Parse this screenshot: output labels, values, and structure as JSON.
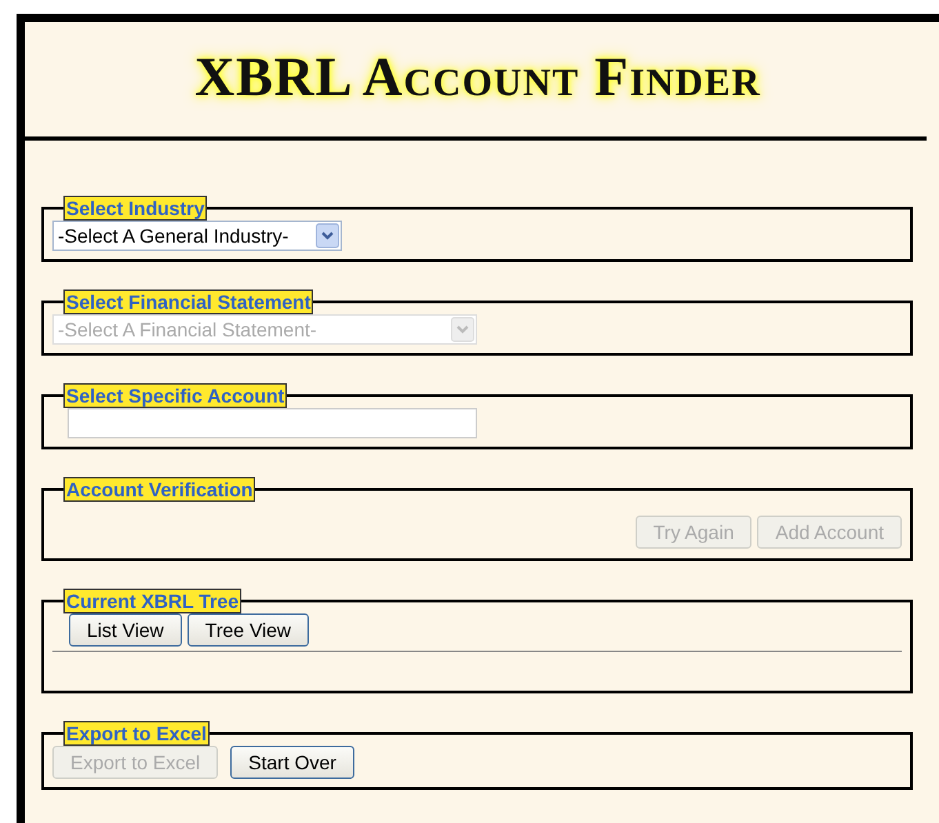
{
  "title": "XBRL Account Finder",
  "sections": [
    {
      "kind": "select",
      "legend": "Select Industry",
      "value": "-Select A General Industry-",
      "disabled": false
    },
    {
      "kind": "select",
      "legend": "Select Financial Statement",
      "value": "-Select A Financial Statement-",
      "disabled": true
    },
    {
      "kind": "input",
      "legend": "Select Specific Account"
    },
    {
      "kind": "verification",
      "legend": "Account Verification",
      "buttons": [
        {
          "label": "Try Again",
          "disabled": true
        },
        {
          "label": "Add Account",
          "disabled": true
        }
      ]
    },
    {
      "kind": "tree",
      "legend": "Current XBRL Tree",
      "buttons": [
        {
          "label": "List View",
          "disabled": false
        },
        {
          "label": "Tree View",
          "disabled": false
        }
      ]
    },
    {
      "kind": "export",
      "legend": "Export to Excel",
      "buttons": [
        {
          "label": "Export to Excel",
          "disabled": true
        },
        {
          "label": "Start Over",
          "disabled": false
        }
      ]
    }
  ]
}
